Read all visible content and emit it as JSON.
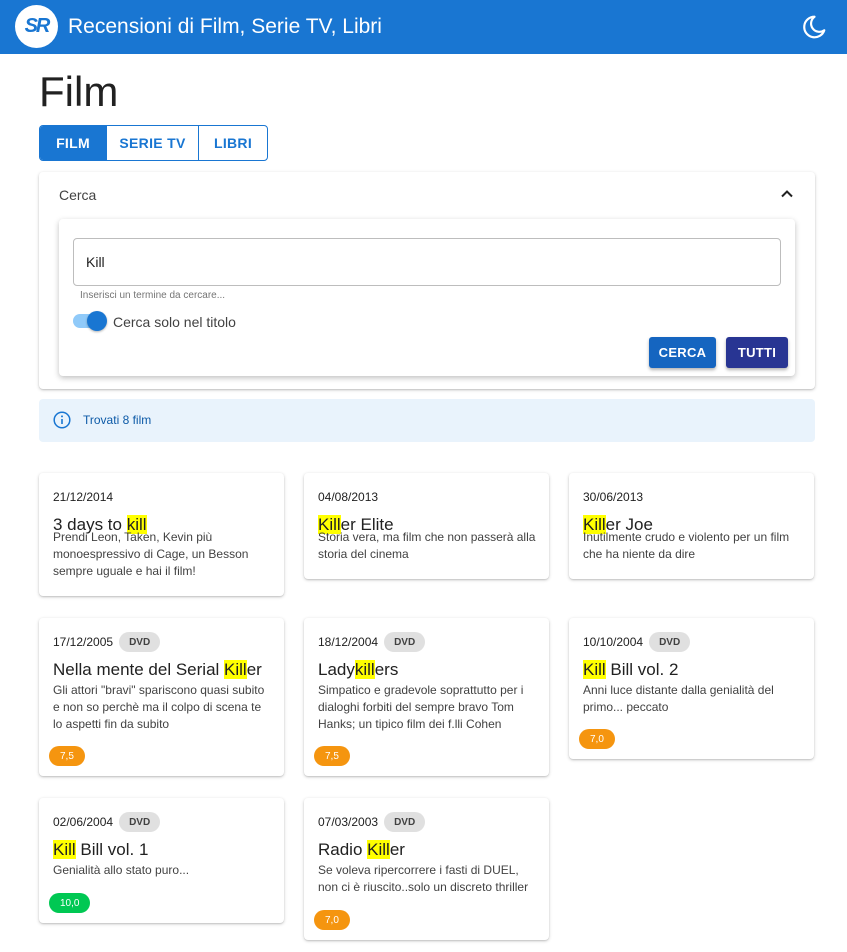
{
  "appbar": {
    "logo_text": "SR",
    "title": "Recensioni di Film, Serie TV, Libri",
    "theme_icon": "moon-icon"
  },
  "page": {
    "title": "Film"
  },
  "tabs": [
    {
      "label": "FILM",
      "active": true
    },
    {
      "label": "SERIE TV",
      "active": false
    },
    {
      "label": "LIBRI",
      "active": false
    }
  ],
  "search": {
    "panel_label": "Cerca",
    "value": "Kill",
    "hint": "Inserisci un termine da cercare...",
    "toggle_label": "Cerca solo nel titolo",
    "toggle_on": true,
    "search_button": "CERCA",
    "all_button": "TUTTI"
  },
  "result": {
    "text": "Trovati 8 film",
    "icon": "info-icon"
  },
  "colors": {
    "primary": "#1976d2",
    "highlight": "#ffff00",
    "rating_orange": "#f5950f",
    "rating_green": "#00c853"
  },
  "cards": [
    {
      "date": "21/12/2014",
      "badge": "",
      "title_pre": "3 days to ",
      "title_hl": "kill",
      "title_post": "",
      "desc": "Prendi Leon, Taken, Kevin più monoespressivo di Cage, un Besson sempre uguale e hai il film!",
      "rating": ""
    },
    {
      "date": "04/08/2013",
      "badge": "",
      "title_pre": "",
      "title_hl": "Kill",
      "title_post": "er Elite",
      "desc": "Storia vera, ma film che non passerà alla storia del cinema",
      "rating": ""
    },
    {
      "date": "30/06/2013",
      "badge": "",
      "title_pre": "",
      "title_hl": "Kill",
      "title_post": "er Joe",
      "desc": "Inutilmente crudo e violento per un film che ha niente da dire",
      "rating": ""
    },
    {
      "date": "17/12/2005",
      "badge": "DVD",
      "title_pre": "Nella mente del Serial ",
      "title_hl": "Kill",
      "title_post": "er",
      "desc": "Gli attori \"bravi\" spariscono quasi subito e non so perchè ma il colpo di scena te lo aspetti fin da subito",
      "rating": "7,5"
    },
    {
      "date": "18/12/2004",
      "badge": "DVD",
      "title_pre": "Lady",
      "title_hl": "kill",
      "title_post": "ers",
      "desc": "Simpatico e gradevole soprattutto per i dialoghi forbiti del sempre bravo Tom Hanks; un tipico film dei f.lli Cohen",
      "rating": "7,5"
    },
    {
      "date": "10/10/2004",
      "badge": "DVD",
      "title_pre": "",
      "title_hl": "Kill",
      "title_post": " Bill vol. 2",
      "desc": "Anni luce distante dalla genialità del primo... peccato",
      "rating": "7,0"
    },
    {
      "date": "02/06/2004",
      "badge": "DVD",
      "title_pre": "",
      "title_hl": "Kill",
      "title_post": " Bill vol. 1",
      "desc": "Genialità allo stato puro...",
      "rating": "10,0"
    },
    {
      "date": "07/03/2003",
      "badge": "DVD",
      "title_pre": "Radio ",
      "title_hl": "Kill",
      "title_post": "er",
      "desc": "Se voleva ripercorrere i fasti di DUEL, non ci è riuscito..solo un discreto thriller",
      "rating": "7,0"
    }
  ]
}
